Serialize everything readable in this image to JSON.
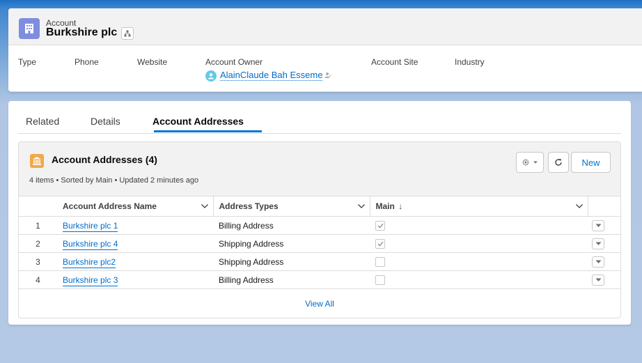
{
  "header": {
    "entity_label": "Account",
    "record_name": "Burkshire plc",
    "icon": "account-building-icon",
    "fields": {
      "type_label": "Type",
      "phone_label": "Phone",
      "website_label": "Website",
      "owner_label": "Account Owner",
      "owner_value": "AlainClaude Bah Esseme",
      "site_label": "Account Site",
      "industry_label": "Industry"
    }
  },
  "tabs": [
    {
      "label": "Related",
      "active": false
    },
    {
      "label": "Details",
      "active": false
    },
    {
      "label": "Account Addresses",
      "active": true
    }
  ],
  "related_list": {
    "title": "Account Addresses (4)",
    "meta": "4 items • Sorted by Main • Updated 2 minutes ago",
    "icon": "bank-building-icon",
    "new_label": "New",
    "columns": [
      "Account Address Name",
      "Address Types",
      "Main"
    ],
    "main_sort_indicator": "↓",
    "rows": [
      {
        "num": "1",
        "name": "Burkshire plc 1",
        "type": "Billing Address",
        "main": true
      },
      {
        "num": "2",
        "name": "Burkshire plc 4",
        "type": "Shipping Address",
        "main": true
      },
      {
        "num": "3",
        "name": "Burkshire plc2",
        "type": "Shipping Address",
        "main": false
      },
      {
        "num": "4",
        "name": "Burkshire plc 3",
        "type": "Billing Address",
        "main": false
      }
    ],
    "view_all": "View All"
  },
  "colors": {
    "brand_blue": "#0176d3",
    "link_blue": "#006dcc",
    "account_icon": "#7f8de1",
    "address_icon": "#f2a94a"
  }
}
